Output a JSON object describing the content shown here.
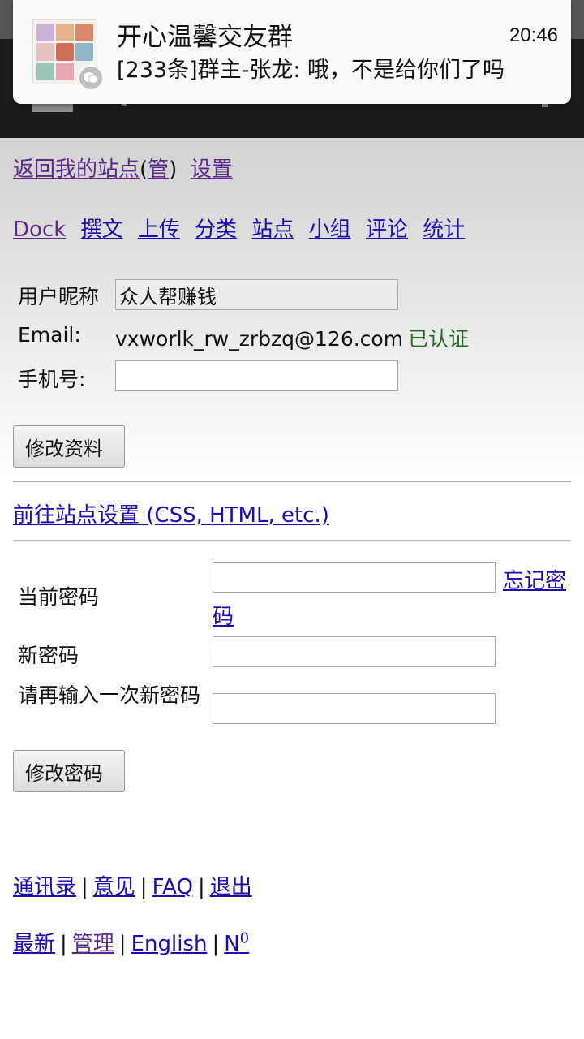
{
  "notification": {
    "title": "开心温馨交友群",
    "time": "20:46",
    "message": "[233条]群主-张龙: 哦，不是给你们了吗",
    "badge_icon": "wechat-icon"
  },
  "top_links": {
    "back": "返回我的站点",
    "open_paren": "(",
    "manage": "管",
    "close_paren": ")",
    "settings": "设置"
  },
  "nav": [
    "Dock",
    "撰文",
    "上传",
    "分类",
    "站点",
    "小组",
    "评论",
    "统计"
  ],
  "profile": {
    "nickname_label": "用户昵称",
    "nickname_value": "众人帮赚钱",
    "email_label": "Email:",
    "email_value": "vxworlk_rw_zrbzq@126.com",
    "verified": "已认证",
    "phone_label": "手机号:",
    "phone_value": "",
    "update_button": "修改资料"
  },
  "site_settings_link": "前往站点设置 (CSS, HTML, etc.)",
  "password": {
    "current_label": "当前密码",
    "forgot_link": "忘记密码",
    "new_label": "新密码",
    "confirm_label": "请再输入一次新密码",
    "change_button": "修改密码"
  },
  "footer1": [
    "通讯录",
    "意见",
    "FAQ",
    "退出"
  ],
  "footer2": {
    "latest": "最新",
    "manage": "管理",
    "english": "English",
    "n_base": "N",
    "n_sup": "0"
  },
  "colors": {
    "link": "#1a0dab",
    "visited_link": "#5a2a86",
    "verified": "#1f6b1f"
  }
}
